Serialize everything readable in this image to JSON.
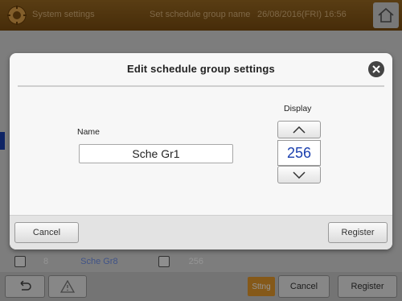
{
  "header": {
    "app_title": "System settings",
    "screen_title": "Set schedule group name",
    "datetime": "26/08/2016(FRI) 16:56"
  },
  "background_list": {
    "row_number": "8",
    "row_name": "Sche Gr8",
    "row_display": "256"
  },
  "bottom_bar": {
    "sttng_label": "Sttng",
    "cancel_label": "Cancel",
    "register_label": "Register"
  },
  "modal": {
    "title": "Edit schedule group settings",
    "name_label": "Name",
    "name_value": "Sche Gr1",
    "display_label": "Display",
    "display_value": "256",
    "cancel_label": "Cancel",
    "register_label": "Register"
  },
  "colors": {
    "header_brown": "#8a5a18",
    "accent_blue": "#1a3fae",
    "sttng_orange": "#e59a2c"
  }
}
